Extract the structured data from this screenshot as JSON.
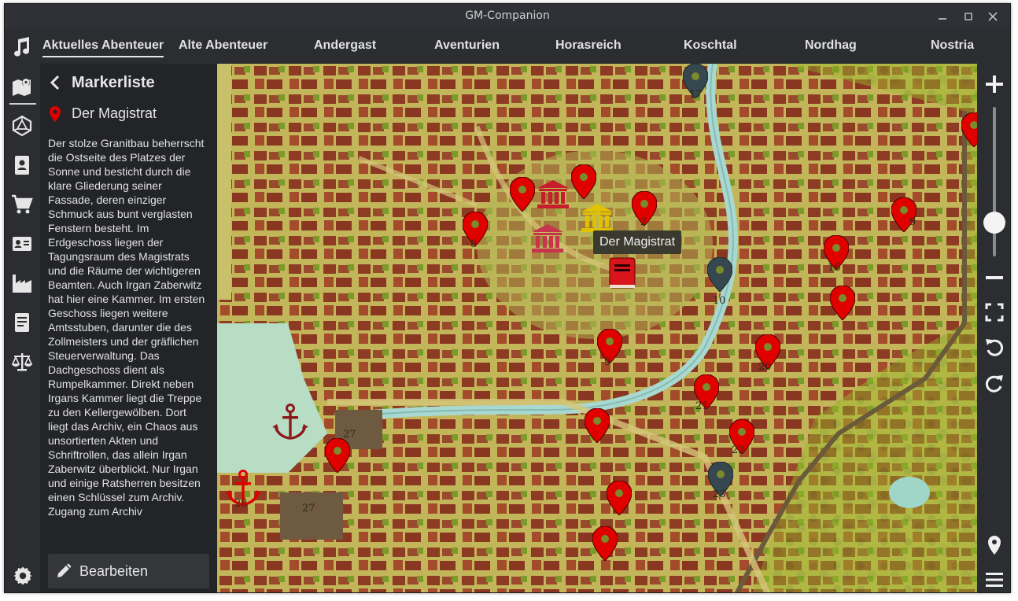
{
  "window": {
    "title": "GM-Companion"
  },
  "tabs": [
    {
      "label": "Aktuelles Abenteuer",
      "active": true
    },
    {
      "label": "Alte Abenteuer"
    },
    {
      "label": "Andergast"
    },
    {
      "label": "Aventurien"
    },
    {
      "label": "Horasreich"
    },
    {
      "label": "Koschtal"
    },
    {
      "label": "Nordhag"
    },
    {
      "label": "Nostria"
    }
  ],
  "rail": [
    "music-icon",
    "map-icon",
    "dice-icon",
    "npc-icon",
    "shop-icon",
    "contacts-icon",
    "industry-icon",
    "notes-icon",
    "scales-icon",
    "settings-icon"
  ],
  "panel": {
    "title": "Markerliste",
    "marker_name": "Der Magistrat",
    "description": "Der stolze Granitbau beherrscht die Ostseite des Platzes der Sonne und besticht durch die klare Gliederung seiner Fassade, deren einziger Schmuck aus bunt verglasten Fenstern besteht. Im Erdgeschoss liegen der Tagungsraum des Magistrats und die Räume der wichtigeren Beamten. Auch Irgan Zaberwitz hat hier eine Kammer. Im ersten Geschoss liegen weitere Amtsstuben, darunter die des Zollmeisters und der gräflichen Steuerverwaltung. Das Dachgeschoss dient als Rumpelkammer. Direkt neben Irgans Kammer liegt die Treppe zu den Kellergewölben. Dort liegt das Archiv, ein Chaos aus unsortierten Akten und Schriftrollen, das allein Irgan Zaberwitz überblickt. Nur Irgan und einige Ratsherren besitzen einen Schlüssel zum Archiv. Zugang zum Archiv",
    "edit_label": "Bearbeiten"
  },
  "map": {
    "tooltip": "Der Magistrat",
    "labels": [
      "17",
      "8",
      "2",
      "9",
      "16",
      "10",
      "9",
      "20",
      "21",
      "22",
      "23",
      "27",
      "27",
      "28"
    ],
    "colors": {
      "red_marker": "#e00000",
      "dark_marker": "#37474f",
      "gold_building": "#e2c200",
      "crimson_building": "#c81d2a"
    }
  },
  "controls": {
    "zoom_level": 0.35
  }
}
